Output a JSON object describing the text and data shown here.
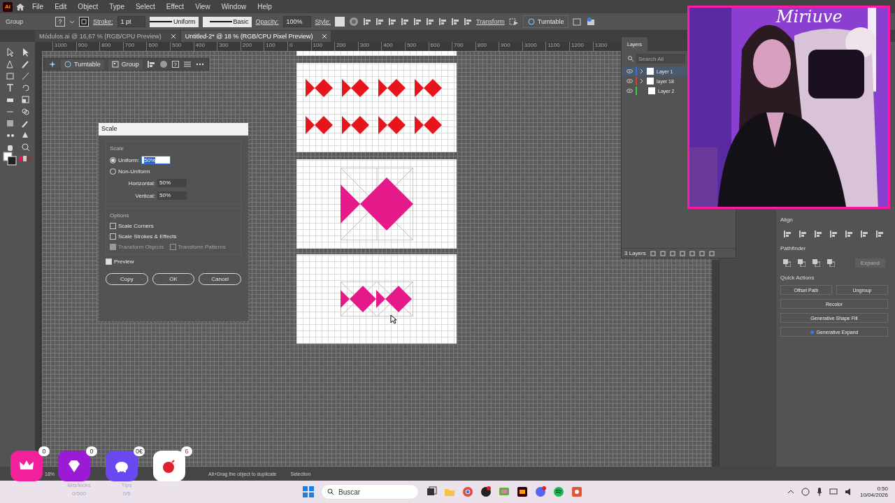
{
  "app": {
    "logo": "Ai",
    "menu": [
      "File",
      "Edit",
      "Object",
      "Type",
      "Select",
      "Effect",
      "View",
      "Window",
      "Help"
    ]
  },
  "control_bar": {
    "selection": "Group",
    "fill_glyph": "?",
    "stroke_label": "Stroke:",
    "stroke_value": "1 pt",
    "profile": "Uniform",
    "brush": "Basic",
    "opacity_label": "Opacity:",
    "opacity_value": "100%",
    "style_label": "Style:",
    "transform": "Transform",
    "turntable": "Turntable"
  },
  "doc_tabs": [
    {
      "label": "Módulos.ai @ 16,67 % (RGB/CPU Preview)",
      "selected": false
    },
    {
      "label": "Untitled-2* @ 18 % (RGB/CPU Pixel Preview)",
      "selected": true
    }
  ],
  "ruler": {
    "ticks": [
      "1000",
      "900",
      "800",
      "700",
      "600",
      "500",
      "400",
      "300",
      "200",
      "100",
      "0",
      "100",
      "200",
      "300",
      "400",
      "500",
      "600",
      "700",
      "800",
      "900",
      "1000",
      "1100",
      "1200",
      "1300"
    ]
  },
  "context_bar": {
    "turntable": "Turntable",
    "group": "Group",
    "help": "?"
  },
  "artboards": [
    {
      "kind": "cut"
    },
    {
      "kind": "bowties"
    },
    {
      "kind": "big"
    },
    {
      "kind": "small"
    }
  ],
  "scale_dialog": {
    "title": "Scale",
    "section": "Scale",
    "uniform": {
      "label": "Uniform:",
      "value": "50%",
      "selected": true
    },
    "non_uniform": {
      "label": "Non-Uniform",
      "selected": false
    },
    "horizontal": {
      "label": "Horizontal:",
      "value": "50%"
    },
    "vertical": {
      "label": "Vertical:",
      "value": "50%"
    },
    "options_title": "Options",
    "options": [
      {
        "label": "Scale Corners",
        "checked": false,
        "disabled": false
      },
      {
        "label": "Scale Strokes & Effects",
        "checked": false,
        "disabled": false
      }
    ],
    "transform_options": [
      {
        "label": "Transform Objects",
        "checked": true,
        "disabled": true
      },
      {
        "label": "Transform Patterns",
        "checked": false,
        "disabled": true
      }
    ],
    "preview": {
      "label": "Preview",
      "checked": true
    },
    "buttons": [
      "Copy",
      "OK",
      "Cancel"
    ]
  },
  "layers": {
    "title": "Layers",
    "search_placeholder": "Search All",
    "count": "3 Layers",
    "rows": [
      {
        "name": "Layer 1",
        "color": "#3d6fd6",
        "selected": true,
        "expandable": true
      },
      {
        "name": "layer 18",
        "color": "#d63a3a",
        "selected": false,
        "expandable": true
      },
      {
        "name": "Layer 2",
        "color": "#3ccf3c",
        "selected": false,
        "expandable": false
      }
    ]
  },
  "properties": {
    "align_title": "Align",
    "pathfinder_title": "Pathfinder",
    "expand": {
      "label": "Expand",
      "disabled": true
    },
    "quick_actions_title": "Quick Actions",
    "quick_actions": [
      {
        "label": "Offset Path",
        "dot": false
      },
      {
        "label": "Ungroup",
        "dot": false
      },
      {
        "label": "Recolor",
        "dot": false
      },
      {
        "label": "Generative Shape Fill",
        "dot": false
      },
      {
        "label": "Generative Expand",
        "dot": true
      }
    ]
  },
  "status_bar": {
    "zoom": "18%",
    "hint": "Alt+Drag the object to duplicate",
    "tool": "Selection"
  },
  "webcam": {
    "kind": "picture",
    "overlay_title": "Miriuve"
  },
  "stream_widgets": [
    {
      "kind": "crown",
      "count": "0"
    },
    {
      "kind": "gem",
      "count": "0",
      "caption": "Bits/kicks",
      "goal": "0/500"
    },
    {
      "kind": "piggy",
      "count": "0€",
      "caption": "Tips",
      "goal": "0/5"
    },
    {
      "kind": "bomb",
      "count": "6"
    }
  ],
  "taskbar": {
    "search_placeholder": "Buscar",
    "time": "0:50",
    "date": "10/04/2026"
  }
}
